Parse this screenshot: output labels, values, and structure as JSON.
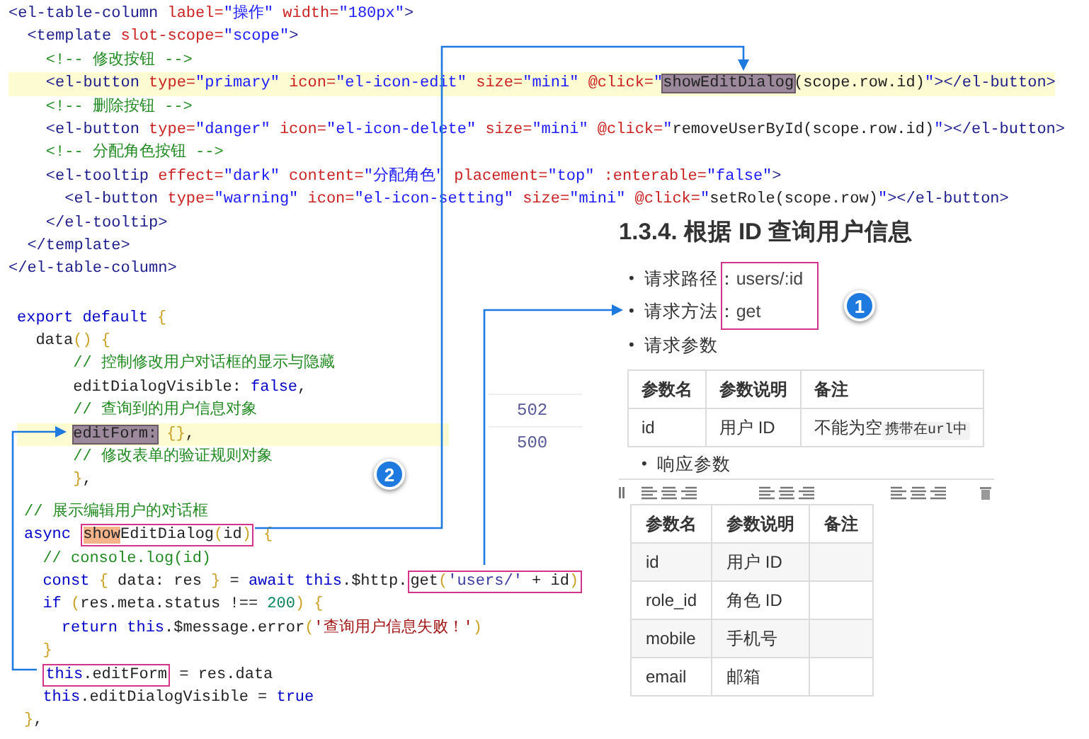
{
  "code_blocks": [
    {
      "lines": [
        {
          "highlighted": false,
          "tokens": [
            {
              "kind": "tag",
              "text": "<el-table-column "
            },
            {
              "kind": "attr",
              "text": "label="
            },
            {
              "kind": "str",
              "text": "\"操作\""
            },
            {
              "kind": "attr",
              "text": " width="
            },
            {
              "kind": "str",
              "text": "\"180px\""
            },
            {
              "kind": "tag",
              "text": ">"
            }
          ]
        },
        {
          "highlighted": false,
          "tokens": [
            {
              "kind": "tag",
              "text": "  <template "
            },
            {
              "kind": "attr",
              "text": "slot-scope="
            },
            {
              "kind": "str",
              "text": "\"scope\""
            },
            {
              "kind": "tag",
              "text": ">"
            }
          ]
        },
        {
          "highlighted": false,
          "tokens": [
            {
              "kind": "cm",
              "text": "    <!-- 修改按钮 -->"
            }
          ]
        },
        {
          "highlighted": true,
          "tokens": [
            {
              "kind": "tag",
              "text": "    <el-button "
            },
            {
              "kind": "attr",
              "text": "type="
            },
            {
              "kind": "str",
              "text": "\"primary\""
            },
            {
              "kind": "attr",
              "text": " icon="
            },
            {
              "kind": "str",
              "text": "\"el-icon-edit\""
            },
            {
              "kind": "attr",
              "text": " size="
            },
            {
              "kind": "str",
              "text": "\"mini\""
            },
            {
              "kind": "attr",
              "text": " @click="
            },
            {
              "kind": "str",
              "text": "\""
            },
            {
              "kind": "sel",
              "text": "showEditDialog"
            },
            {
              "kind": "pl",
              "text": "(scope.row.id)"
            },
            {
              "kind": "str",
              "text": "\""
            },
            {
              "kind": "tag",
              "text": "></el-button>"
            }
          ]
        },
        {
          "highlighted": false,
          "tokens": [
            {
              "kind": "cm",
              "text": "    <!-- 删除按钮 -->"
            }
          ]
        },
        {
          "highlighted": false,
          "tokens": [
            {
              "kind": "tag",
              "text": "    <el-button "
            },
            {
              "kind": "attr",
              "text": "type="
            },
            {
              "kind": "str",
              "text": "\"danger\""
            },
            {
              "kind": "attr",
              "text": " icon="
            },
            {
              "kind": "str",
              "text": "\"el-icon-delete\""
            },
            {
              "kind": "attr",
              "text": " size="
            },
            {
              "kind": "str",
              "text": "\"mini\""
            },
            {
              "kind": "attr",
              "text": " @click="
            },
            {
              "kind": "str",
              "text": "\""
            },
            {
              "kind": "pl",
              "text": "removeUserById(scope.row.id)"
            },
            {
              "kind": "str",
              "text": "\""
            },
            {
              "kind": "tag",
              "text": "></el-button>"
            }
          ]
        },
        {
          "highlighted": false,
          "tokens": [
            {
              "kind": "cm",
              "text": "    <!-- 分配角色按钮 -->"
            }
          ]
        },
        {
          "highlighted": false,
          "tokens": [
            {
              "kind": "tag",
              "text": "    <el-tooltip "
            },
            {
              "kind": "attr",
              "text": "effect="
            },
            {
              "kind": "str",
              "text": "\"dark\""
            },
            {
              "kind": "attr",
              "text": " content="
            },
            {
              "kind": "str",
              "text": "\"分配角色\""
            },
            {
              "kind": "attr",
              "text": " placement="
            },
            {
              "kind": "str",
              "text": "\"top\""
            },
            {
              "kind": "attr",
              "text": " :enterable="
            },
            {
              "kind": "str",
              "text": "\"false\""
            },
            {
              "kind": "tag",
              "text": ">"
            }
          ]
        },
        {
          "highlighted": false,
          "tokens": [
            {
              "kind": "tag",
              "text": "      <el-button "
            },
            {
              "kind": "attr",
              "text": "type="
            },
            {
              "kind": "str",
              "text": "\"warning\""
            },
            {
              "kind": "attr",
              "text": " icon="
            },
            {
              "kind": "str",
              "text": "\"el-icon-setting\""
            },
            {
              "kind": "attr",
              "text": " size="
            },
            {
              "kind": "str",
              "text": "\"mini\""
            },
            {
              "kind": "attr",
              "text": " @click="
            },
            {
              "kind": "str",
              "text": "\""
            },
            {
              "kind": "pl",
              "text": "setRole(scope.row)"
            },
            {
              "kind": "str",
              "text": "\""
            },
            {
              "kind": "tag",
              "text": "></el-button>"
            }
          ]
        },
        {
          "highlighted": false,
          "tokens": [
            {
              "kind": "tag",
              "text": "    </el-tooltip>"
            }
          ]
        },
        {
          "highlighted": false,
          "tokens": [
            {
              "kind": "tag",
              "text": "  </template>"
            }
          ]
        },
        {
          "highlighted": false,
          "tokens": [
            {
              "kind": "tag",
              "text": "</el-table-column>"
            }
          ]
        }
      ]
    },
    {
      "lines": [
        {
          "highlighted": false,
          "tokens": [
            {
              "kind": "kw",
              "text": "export default "
            },
            {
              "kind": "br",
              "text": "{"
            }
          ]
        },
        {
          "highlighted": false,
          "tokens": [
            {
              "kind": "pl",
              "text": "  data"
            },
            {
              "kind": "br",
              "text": "() {"
            }
          ]
        },
        {
          "highlighted": false,
          "tokens": [
            {
              "kind": "cm",
              "text": "      // 控制修改用户对话框的显示与隐藏"
            }
          ]
        },
        {
          "highlighted": false,
          "tokens": [
            {
              "kind": "pl",
              "text": "      editDialogVisible: "
            },
            {
              "kind": "kw",
              "text": "false"
            },
            {
              "kind": "pl",
              "text": ","
            }
          ]
        },
        {
          "highlighted": false,
          "tokens": [
            {
              "kind": "cm",
              "text": "      // 查询到的用户信息对象"
            }
          ]
        },
        {
          "highlighted": true,
          "tokens": [
            {
              "kind": "sel",
              "text": "      editForm:"
            },
            {
              "kind": "br",
              "text": " {}"
            },
            {
              "kind": "pl",
              "text": ","
            }
          ]
        },
        {
          "highlighted": false,
          "tokens": [
            {
              "kind": "cm",
              "text": "      // 修改表单的验证规则对象"
            }
          ]
        },
        {
          "highlighted": false,
          "tokens": [
            {
              "kind": "br",
              "text": "      }"
            },
            {
              "kind": "pl",
              "text": ","
            }
          ]
        }
      ]
    },
    {
      "lines": [
        {
          "highlighted": false,
          "tokens": [
            {
              "kind": "cm",
              "text": "// 展示编辑用户的对话框"
            }
          ]
        },
        {
          "highlighted": false,
          "tokens": [
            {
              "kind": "kw",
              "text": "async "
            },
            {
              "kind": "box",
              "parts": [
                {
                  "kind": "match",
                  "text": "show"
                },
                {
                  "kind": "pl",
                  "text": "EditDialog"
                },
                {
                  "kind": "br",
                  "text": "("
                },
                {
                  "kind": "pl",
                  "text": "id"
                },
                {
                  "kind": "br",
                  "text": ")"
                }
              ]
            },
            {
              "kind": "br",
              "text": " {"
            }
          ]
        },
        {
          "highlighted": false,
          "tokens": [
            {
              "kind": "cm",
              "text": "  // console.log(id)"
            }
          ]
        },
        {
          "highlighted": false,
          "tokens": [
            {
              "kind": "kw",
              "text": "  const "
            },
            {
              "kind": "br",
              "text": "{ "
            },
            {
              "kind": "pl",
              "text": "data: res "
            },
            {
              "kind": "br",
              "text": "}"
            },
            {
              "kind": "pl",
              "text": " = "
            },
            {
              "kind": "kw",
              "text": "await this"
            },
            {
              "kind": "pl",
              "text": ".$http."
            },
            {
              "kind": "box",
              "parts": [
                {
                  "kind": "pl",
                  "text": "get"
                },
                {
                  "kind": "br",
                  "text": "("
                },
                {
                  "kind": "jstr",
                  "text": "'users/'"
                },
                {
                  "kind": "pl",
                  "text": " + id"
                },
                {
                  "kind": "br",
                  "text": ")"
                }
              ]
            }
          ]
        },
        {
          "highlighted": false,
          "tokens": [
            {
              "kind": "kw",
              "text": "  if "
            },
            {
              "kind": "br",
              "text": "("
            },
            {
              "kind": "pl",
              "text": "res.meta.status !== "
            },
            {
              "kind": "num",
              "text": "200"
            },
            {
              "kind": "br",
              "text": ")"
            },
            {
              "kind": "br",
              "text": " {"
            }
          ]
        },
        {
          "highlighted": false,
          "tokens": [
            {
              "kind": "kw",
              "text": "    return this"
            },
            {
              "kind": "pl",
              "text": ".$message.error"
            },
            {
              "kind": "br",
              "text": "("
            },
            {
              "kind": "err",
              "text": "'查询用户信息失败！'"
            },
            {
              "kind": "br",
              "text": ")"
            }
          ]
        },
        {
          "highlighted": false,
          "tokens": [
            {
              "kind": "br",
              "text": "  }"
            }
          ]
        },
        {
          "highlighted": false,
          "tokens": [
            {
              "kind": "box",
              "parts": [
                {
                  "kind": "kw",
                  "text": "  this"
                },
                {
                  "kind": "pl",
                  "text": ".editForm"
                }
              ]
            },
            {
              "kind": "pl",
              "text": " = res.data"
            }
          ]
        },
        {
          "highlighted": false,
          "tokens": [
            {
              "kind": "kw",
              "text": "  this"
            },
            {
              "kind": "pl",
              "text": ".editDialogVisible = "
            },
            {
              "kind": "kw",
              "text": "true"
            }
          ]
        },
        {
          "highlighted": false,
          "tokens": [
            {
              "kind": "br",
              "text": "}"
            },
            {
              "kind": "pl",
              "text": ","
            }
          ]
        }
      ]
    }
  ],
  "status_panel": {
    "values": [
      "502",
      "500"
    ]
  },
  "doc": {
    "heading": "1.3.4. 根据 ID 查询用户信息",
    "request_items": [
      {
        "bullet": "•",
        "label": "请求路径：",
        "value": "users/:id"
      },
      {
        "bullet": "•",
        "label": "请求方法：",
        "value": "get"
      },
      {
        "bullet": "•",
        "label": "请求参数"
      }
    ],
    "params_table": {
      "columns": [
        "参数名",
        "参数说明",
        "备注"
      ],
      "rows": [
        {
          "name": "id",
          "description": "用户 ID",
          "note": "不能为空",
          "note_code": "携带在url中"
        }
      ]
    },
    "response_bullet": "•",
    "response_label": "响应参数",
    "response_table": {
      "columns": [
        "参数名",
        "参数说明",
        "备注"
      ],
      "rows": [
        {
          "name": "id",
          "description": "用户 ID"
        },
        {
          "name": "role_id",
          "description": "角色 ID"
        },
        {
          "name": "mobile",
          "description": "手机号"
        },
        {
          "name": "email",
          "description": "邮箱"
        }
      ]
    }
  },
  "callouts": [
    {
      "number": "1"
    },
    {
      "number": "2"
    }
  ]
}
